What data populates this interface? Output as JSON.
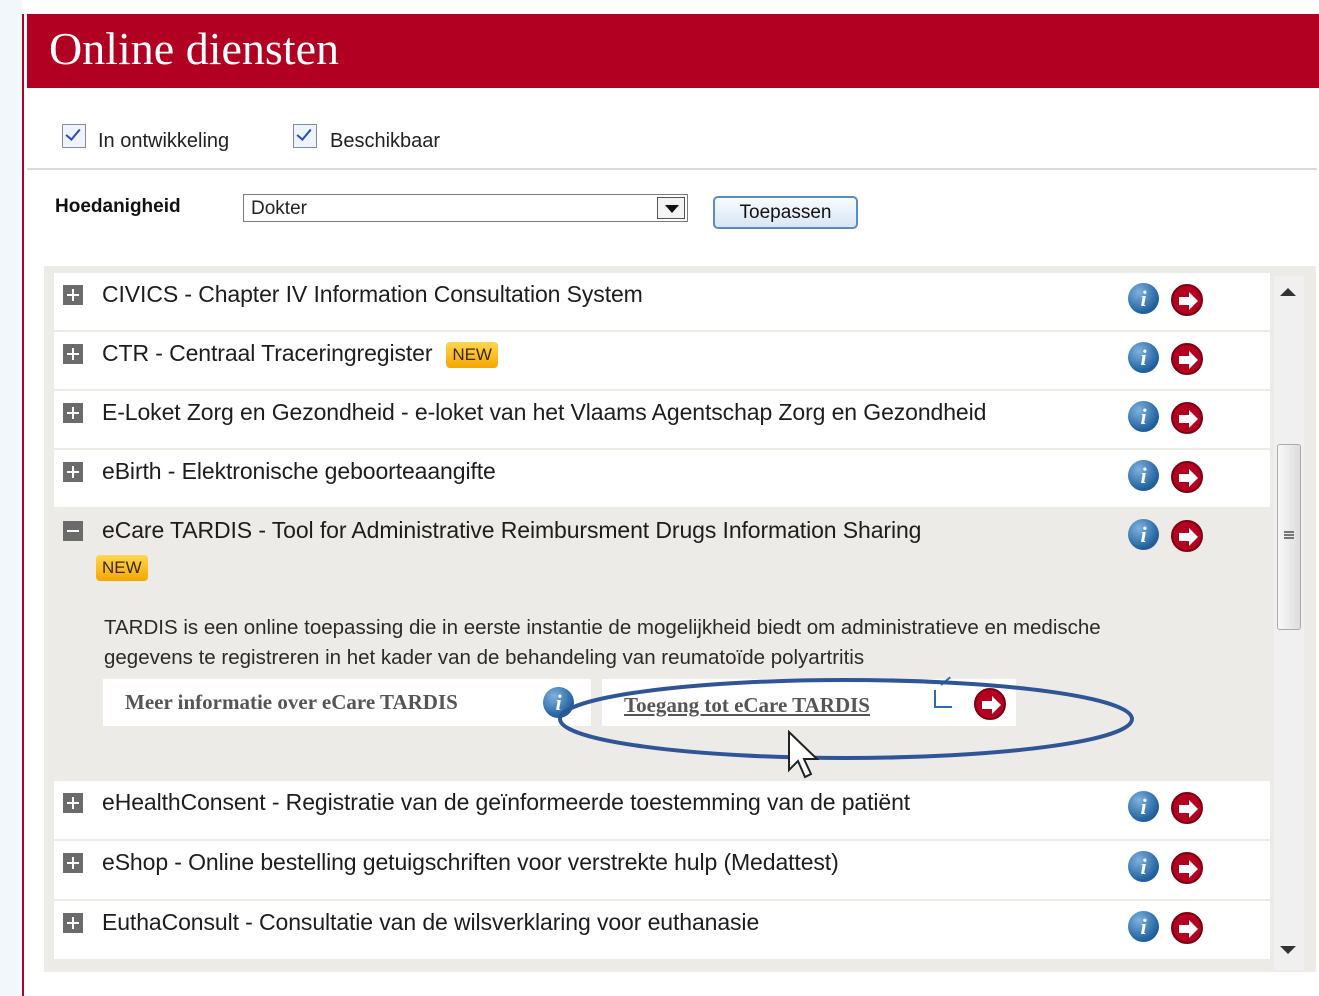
{
  "header": {
    "title": "Online diensten"
  },
  "filters": [
    {
      "label": "In ontwikkeling",
      "checked": true
    },
    {
      "label": "Beschikbaar",
      "checked": true
    }
  ],
  "capacity": {
    "label": "Hoedanigheid",
    "selected": "Dokter",
    "apply_label": "Toepassen"
  },
  "services": [
    {
      "title": "CIVICS - Chapter IV Information Consultation System",
      "is_new": false,
      "expanded": false
    },
    {
      "title": "CTR - Centraal Traceringregister",
      "is_new": true,
      "expanded": false
    },
    {
      "title": "E-Loket Zorg en Gezondheid - e-loket van het Vlaams Agentschap Zorg en Gezondheid",
      "is_new": false,
      "expanded": false
    },
    {
      "title": "eBirth - Elektronische geboorteaangifte",
      "is_new": false,
      "expanded": false
    },
    {
      "title": "eCare TARDIS - Tool for Administrative Reimbursment Drugs Information Sharing",
      "is_new": true,
      "expanded": true
    },
    {
      "title": "eHealthConsent - Registratie van de geïnformeerde toestemming van de patiënt",
      "is_new": false,
      "expanded": false
    },
    {
      "title": "eShop - Online bestelling getuigschriften voor verstrekte hulp (Medattest)",
      "is_new": false,
      "expanded": false
    },
    {
      "title": "EuthaConsult - Consultatie van de wilsverklaring voor euthanasie",
      "is_new": false,
      "expanded": false
    }
  ],
  "badge_label": "NEW",
  "expanded_detail": {
    "description": "TARDIS is een online toepassing die in eerste instantie de mogelijkheid biedt om administratieve en medische gegevens te registreren in het kader van de behandeling van reumatoïde polyartritis",
    "more_info_label": "Meer informatie over eCare TARDIS",
    "access_label": "Toegang tot eCare TARDIS"
  },
  "colors": {
    "brand_red": "#b20022",
    "info_blue": "#1e5f9c",
    "badge_orange": "#f4a700",
    "highlight_oval": "#2f5597"
  },
  "icons": {
    "info": "info-icon",
    "go": "arrow-right-circle-icon",
    "external": "external-link-icon",
    "expand": "plus-box-icon",
    "collapse": "minus-box-icon"
  }
}
